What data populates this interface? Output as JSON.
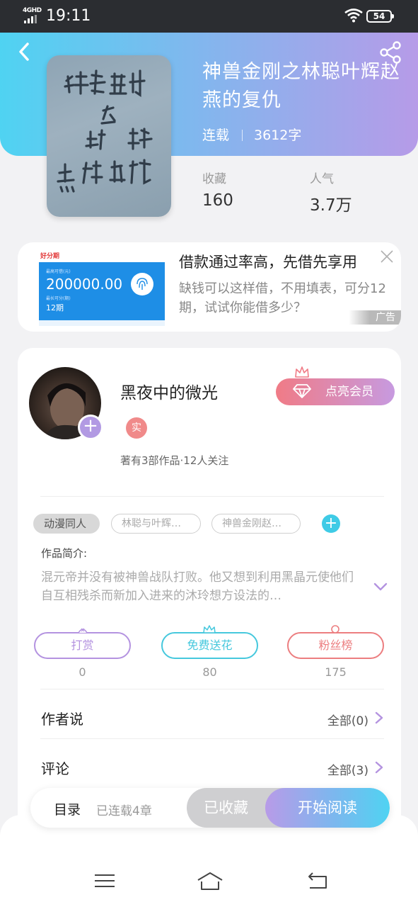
{
  "status_bar": {
    "network": "4GHD",
    "time": "19:11",
    "battery": "54"
  },
  "book": {
    "title": "神兽金刚之林聪叶辉赵燕的复仇",
    "status": "连载",
    "word_count": "3612字",
    "collect_label": "收藏",
    "collect_value": "160",
    "popularity_label": "人气",
    "popularity_value": "3.7万"
  },
  "ad": {
    "title": "借款通过率高，先借先享用",
    "description": "缺钱可以这样借，不用填表，可分12期，试试你能借多少？",
    "badge": "广告",
    "image": {
      "brand": "好分期",
      "limit_label": "最高可借(元)",
      "amount": "200000.00",
      "term_label": "最长可分(期)",
      "term": "12期"
    }
  },
  "author": {
    "name": "黑夜中的微光",
    "badge": "实",
    "meta": "著有3部作品·12人关注",
    "vip_label": "点亮会员"
  },
  "tags": [
    "动漫同人",
    "林聪与叶辉…",
    "神兽金刚赵…"
  ],
  "intro": {
    "label": "作品简介:",
    "text": "混元帝并没有被神兽战队打败。他又想到利用黑晶元使他们自互相残杀而新加入进来的沐玲想方设法的…"
  },
  "actions": [
    {
      "label": "打赏",
      "count": "0",
      "color": "#b493e0"
    },
    {
      "label": "免费送花",
      "count": "80",
      "color": "#46c8dd"
    },
    {
      "label": "粉丝榜",
      "count": "175",
      "color": "#ec7e80"
    }
  ],
  "rows": [
    {
      "label": "作者说",
      "right": "全部(0)"
    },
    {
      "label": "评论",
      "right": "全部(3)"
    }
  ],
  "bottom_bar": {
    "toc": "目录",
    "serial": "已连载4章",
    "collected": "已收藏",
    "read": "开始阅读"
  },
  "colors": {
    "accent_cyan": "#4fd3f2",
    "accent_purple": "#b69be8",
    "vip_pink": "#f07b86"
  }
}
